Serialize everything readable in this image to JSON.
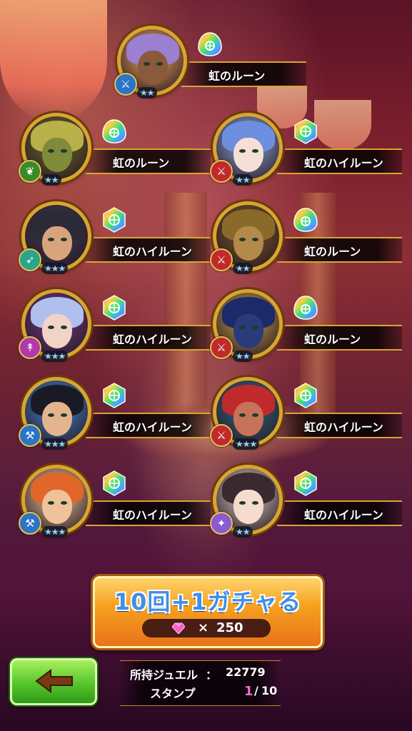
{
  "rewards": [
    {
      "name": "虹のルーン",
      "stars": "★★",
      "rune": "rune",
      "attr_icon": "sword-icon",
      "attr_color": "#2b74c7",
      "skin": "#8a5a3a",
      "hair": "#9b7fd1",
      "bg": "#f4a95e"
    },
    {
      "name": "虹のルーン",
      "stars": "★★",
      "rune": "rune",
      "attr_icon": "leaf-icon",
      "attr_color": "#3a8a2a",
      "skin": "#7f8a3b",
      "hair": "#b8b04a",
      "bg": "#6b6a2a"
    },
    {
      "name": "虹のハイルーン",
      "stars": "★★",
      "rune": "hirune",
      "attr_icon": "sword-icon",
      "attr_color": "#c02a2a",
      "skin": "#f6e0d6",
      "hair": "#6e8ee0",
      "bg": "#8ab0e8"
    },
    {
      "name": "虹のハイルーン",
      "stars": "★★★",
      "rune": "hirune",
      "attr_icon": "bird-icon",
      "attr_color": "#2aa48a",
      "skin": "#d9a47c",
      "hair": "#2b2b38",
      "bg": "#3a3a55"
    },
    {
      "name": "虹のルーン",
      "stars": "★★",
      "rune": "rune",
      "attr_icon": "sword-icon",
      "attr_color": "#c02a2a",
      "skin": "#b48a4a",
      "hair": "#8a6a2a",
      "bg": "#7a5a28"
    },
    {
      "name": "虹のハイルーン",
      "stars": "★★★",
      "rune": "hirune",
      "attr_icon": "spear-icon",
      "attr_color": "#b03aa8",
      "skin": "#f1d4c6",
      "hair": "#b0c0ee",
      "bg": "#6e3a8a"
    },
    {
      "name": "虹のルーン",
      "stars": "★★",
      "rune": "rune",
      "attr_icon": "sword-icon",
      "attr_color": "#c02a2a",
      "skin": "#2a3a7a",
      "hair": "#1c2a6a",
      "bg": "#c9a34a"
    },
    {
      "name": "虹のハイルーン",
      "stars": "★★★",
      "rune": "hirune",
      "attr_icon": "axe-icon",
      "attr_color": "#2b74c7",
      "skin": "#e3b48e",
      "hair": "#1a1a26",
      "bg": "#3a8adf"
    },
    {
      "name": "虹のハイルーン",
      "stars": "★★★",
      "rune": "hirune",
      "attr_icon": "sword-icon",
      "attr_color": "#c02a2a",
      "skin": "#c7735a",
      "hair": "#c02a2a",
      "bg": "#2a6a8a"
    },
    {
      "name": "虹のハイルーン",
      "stars": "★★★",
      "rune": "hirune",
      "attr_icon": "axe-icon",
      "attr_color": "#2b74c7",
      "skin": "#f0c29a",
      "hair": "#e0662a",
      "bg": "#f2cfa0"
    },
    {
      "name": "虹のハイルーン",
      "stars": "★★",
      "rune": "hirune",
      "attr_icon": "magic-icon",
      "attr_color": "#8a5ad0",
      "skin": "#f6dccf",
      "hair": "#3a2a30",
      "bg": "#d9d0c8"
    }
  ],
  "gacha": {
    "title": "10回+1ガチャる",
    "cost_prefix": "×",
    "cost": "250"
  },
  "info": {
    "jewel_label": "所持ジュエル",
    "jewel_sep": "：",
    "jewel_value": "22779",
    "stamp_label": "スタンプ",
    "stamp_current": "1",
    "stamp_sep": "/",
    "stamp_max": "10"
  },
  "colors": {
    "gold": "#d9a531",
    "accent_orange": "#f5a21f",
    "back_green": "#55c52c",
    "stamp_pink": "#ff64c8"
  }
}
